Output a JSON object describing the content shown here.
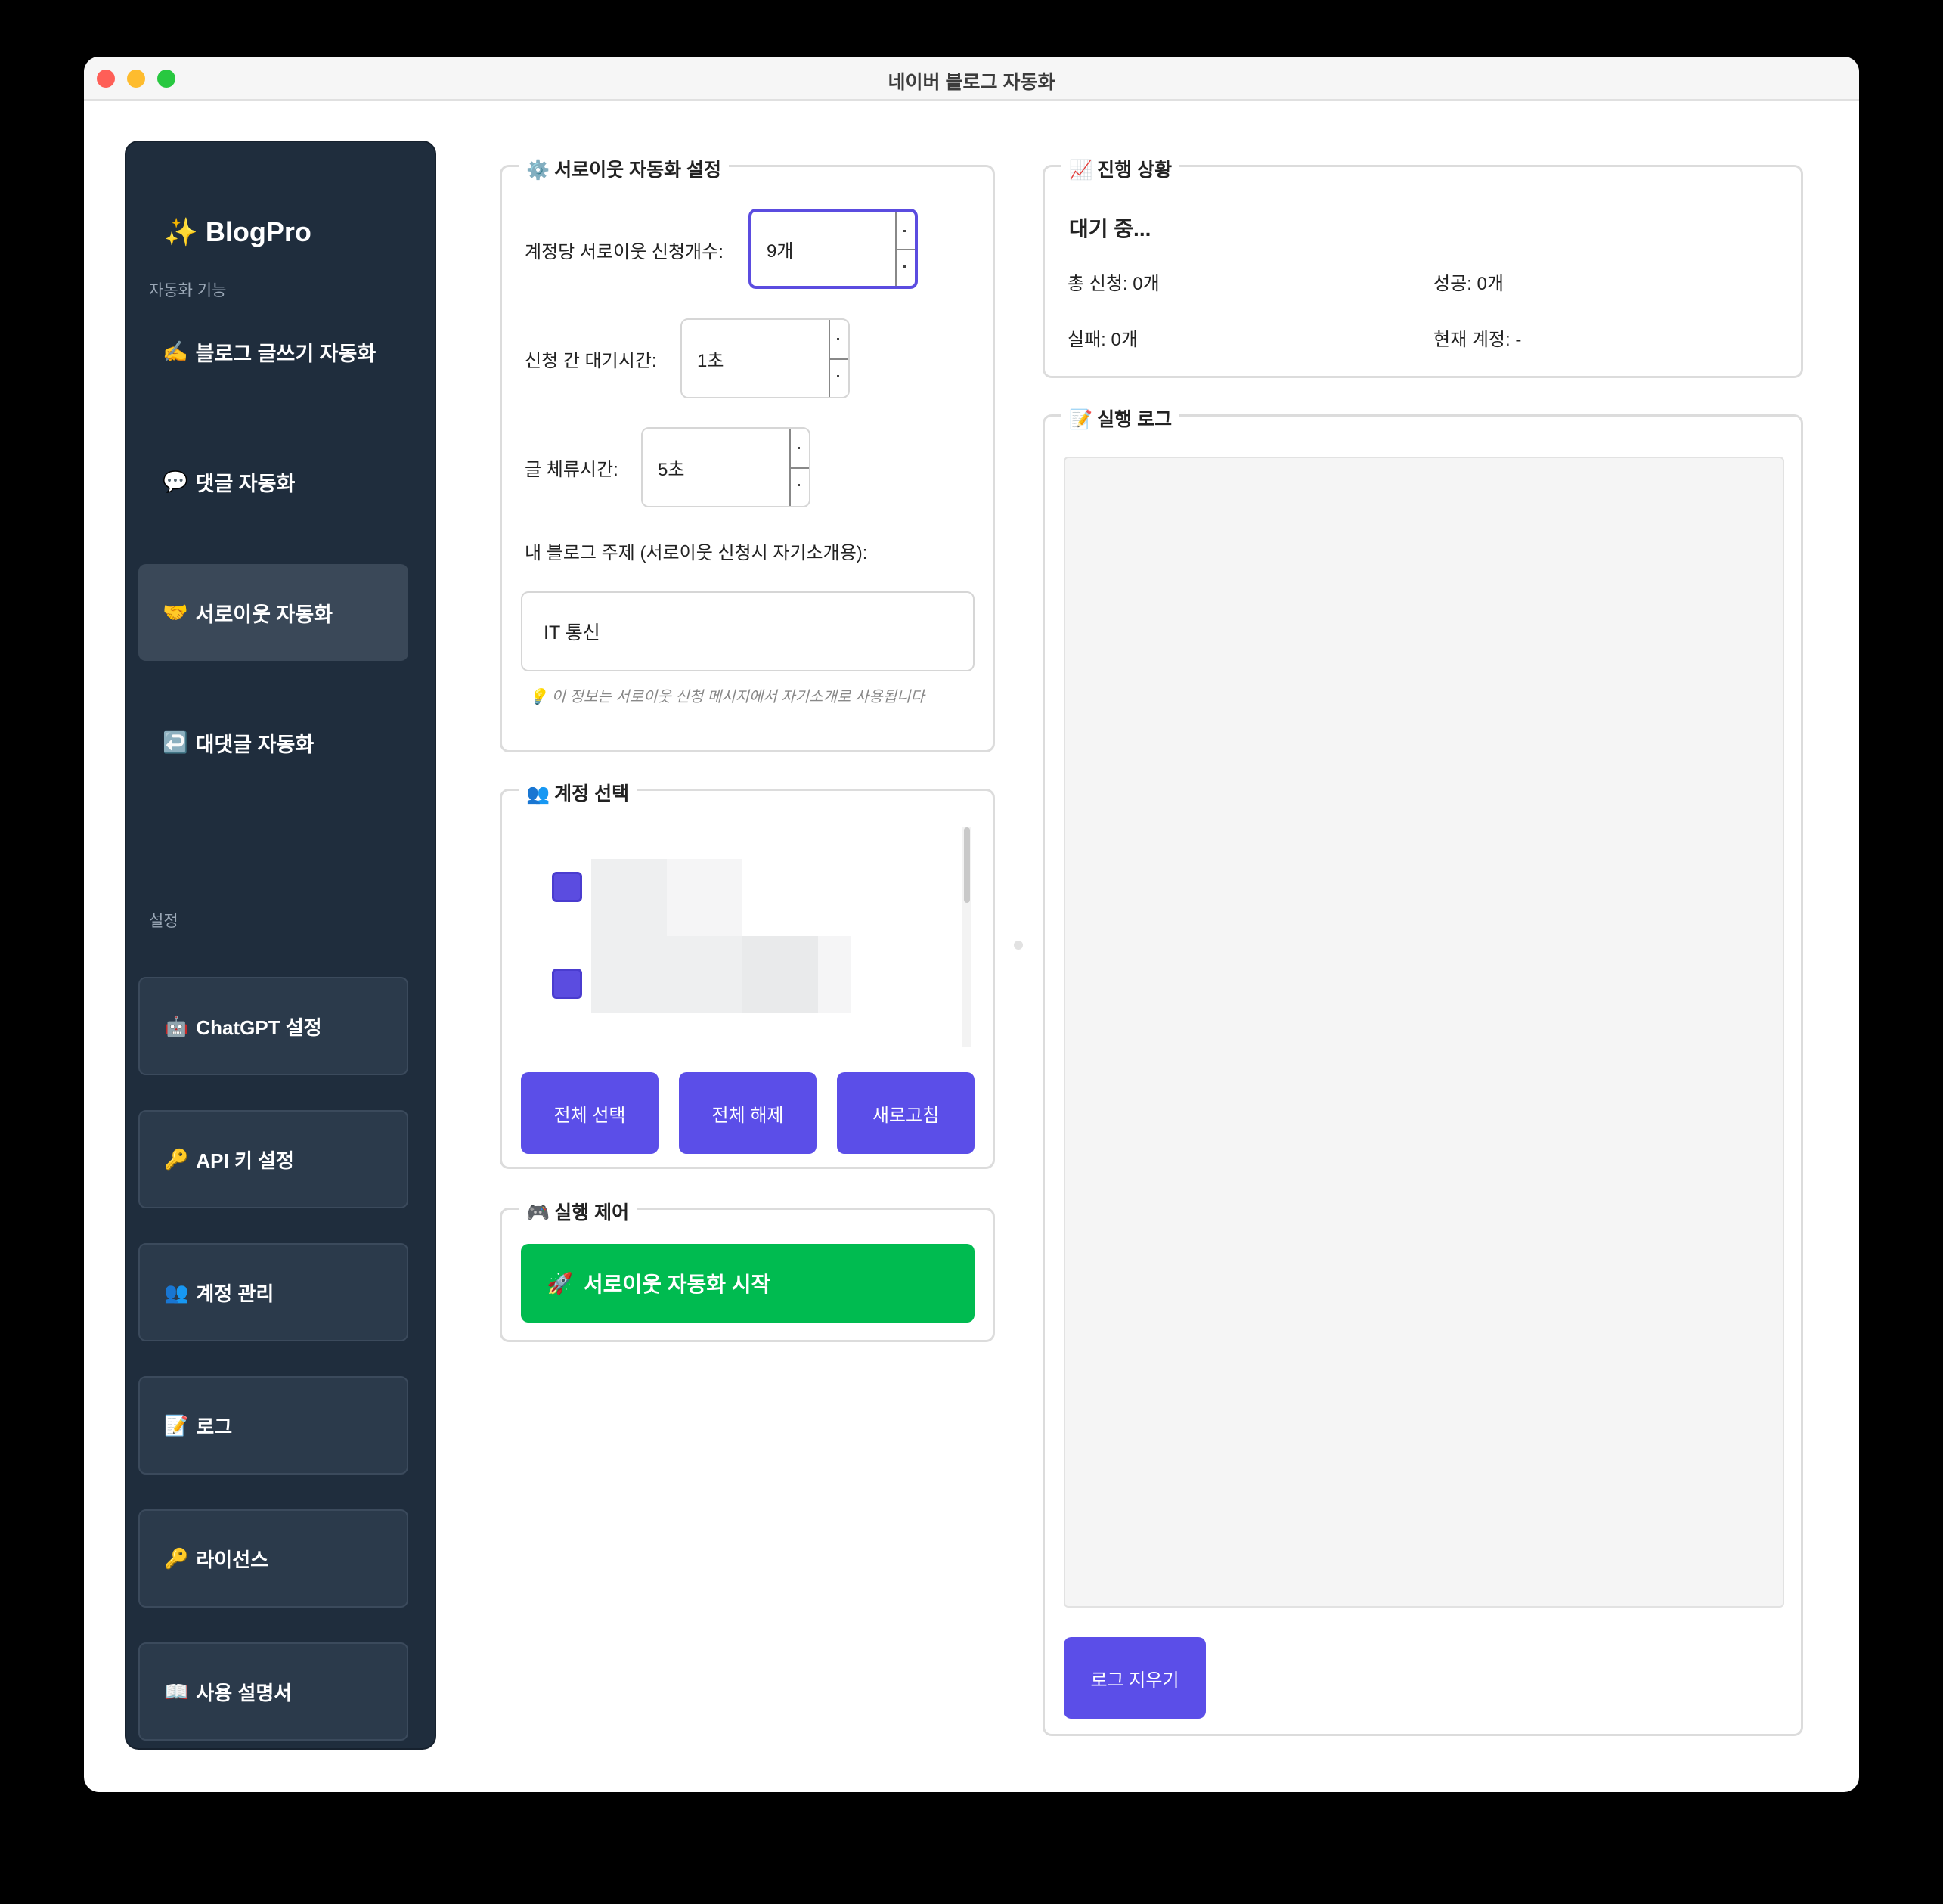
{
  "window": {
    "title": "네이버 블로그 자동화"
  },
  "sidebar": {
    "brand": {
      "icon": "✨",
      "label": "BlogPro"
    },
    "automation_section_label": "자동화 기능",
    "nav_items": [
      {
        "icon": "✍️",
        "label": "블로그 글쓰기 자동화"
      },
      {
        "icon": "💬",
        "label": "댓글 자동화"
      },
      {
        "icon": "🤝",
        "label": "서로이웃 자동화",
        "active": true
      },
      {
        "icon": "↩️",
        "label": "대댓글 자동화"
      }
    ],
    "settings_section_label": "설정",
    "settings_items": [
      {
        "icon": "🤖",
        "label": "ChatGPT 설정"
      },
      {
        "icon": "🔑",
        "label": "API 키 설정"
      },
      {
        "icon": "👥",
        "label": "계정 관리"
      },
      {
        "icon": "📝",
        "label": "로그"
      },
      {
        "icon": "🔑",
        "label": "라이선스"
      },
      {
        "icon": "📖",
        "label": "사용 설명서"
      }
    ]
  },
  "settings_group": {
    "icon": "⚙️",
    "title": "서로이웃 자동화 설정",
    "count_label": "계정당 서로이웃 신청개수:",
    "count_value": "9개",
    "wait_label": "신청 간 대기시간:",
    "wait_value": "1초",
    "stay_label": "글 체류시간:",
    "stay_value": "5초",
    "topic_label": "내 블로그 주제 (서로이웃 신청시 자기소개용):",
    "topic_value": "IT 통신",
    "hint_icon": "💡",
    "hint_text": "이 정보는 서로이웃 신청 메시지에서 자기소개로 사용됩니다"
  },
  "accounts_group": {
    "icon": "👥",
    "title": "계정 선택",
    "select_all": "전체 선택",
    "deselect_all": "전체 해제",
    "refresh": "새로고침"
  },
  "control_group": {
    "icon": "🎮",
    "title": "실행 제어",
    "start_icon": "🚀",
    "start_label": "서로이웃 자동화 시작"
  },
  "progress_group": {
    "icon": "📈",
    "title": "진행 상황",
    "status": "대기 중...",
    "total": "총 신청: 0개",
    "success": "성공: 0개",
    "fail": "실패: 0개",
    "current_account": "현재 계정: -"
  },
  "log_group": {
    "icon": "📝",
    "title": "실행 로그",
    "clear_label": "로그 지우기"
  },
  "colors": {
    "sidebar_bg": "#1f2d3d",
    "accent": "#5b4ee8",
    "start_green": "#00bb50"
  }
}
